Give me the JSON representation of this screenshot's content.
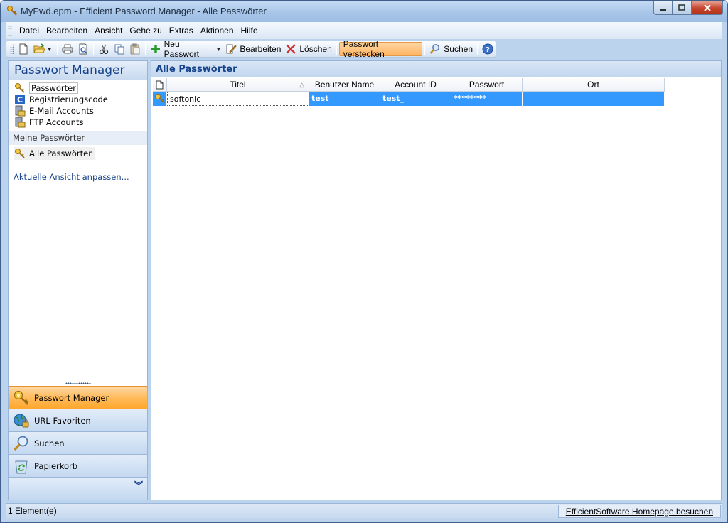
{
  "window": {
    "title": "MyPwd.epm - Efficient Password Manager - Alle Passwörter"
  },
  "menu": {
    "items": [
      "Datei",
      "Bearbeiten",
      "Ansicht",
      "Gehe zu",
      "Extras",
      "Aktionen",
      "Hilfe"
    ]
  },
  "toolbar": {
    "new_password": "Neu Passwort",
    "edit": "Bearbeiten",
    "delete": "Löschen",
    "hide_password": "Passwort verstecken",
    "search": "Suchen"
  },
  "sidebar": {
    "title": "Passwort Manager",
    "categories": [
      {
        "label": "Passwörter",
        "icon": "key-icon"
      },
      {
        "label": "Registrierungscode",
        "icon": "registration-code-icon"
      },
      {
        "label": "E-Mail Accounts",
        "icon": "email-accounts-icon"
      },
      {
        "label": "FTP Accounts",
        "icon": "ftp-accounts-icon"
      }
    ],
    "section_label": "Meine Passwörter",
    "selected_item": "Alle Passwörter",
    "customize_link": "Aktuelle Ansicht anpassen...",
    "nav_buttons": [
      {
        "label": "Passwort Manager",
        "icon": "key-icon",
        "active": true
      },
      {
        "label": "URL Favoriten",
        "icon": "globe-lock-icon",
        "active": false
      },
      {
        "label": "Suchen",
        "icon": "magnifier-icon",
        "active": false
      },
      {
        "label": "Papierkorb",
        "icon": "recycle-bin-icon",
        "active": false
      }
    ]
  },
  "main": {
    "title": "Alle Passwörter",
    "columns": [
      "Titel",
      "Benutzer Name",
      "Account ID",
      "Passwort",
      "Ort"
    ],
    "rows": [
      {
        "title": "softonic",
        "user": "test",
        "account_id": "test_",
        "password": "********",
        "location": ""
      }
    ]
  },
  "status": {
    "count": "1 Element(e)",
    "homepage_link": "EfficientSoftware Homepage besuchen"
  },
  "colors": {
    "accent_blue": "#15428b",
    "selection_blue": "#3399ff",
    "active_orange": "#ffbb5c"
  }
}
